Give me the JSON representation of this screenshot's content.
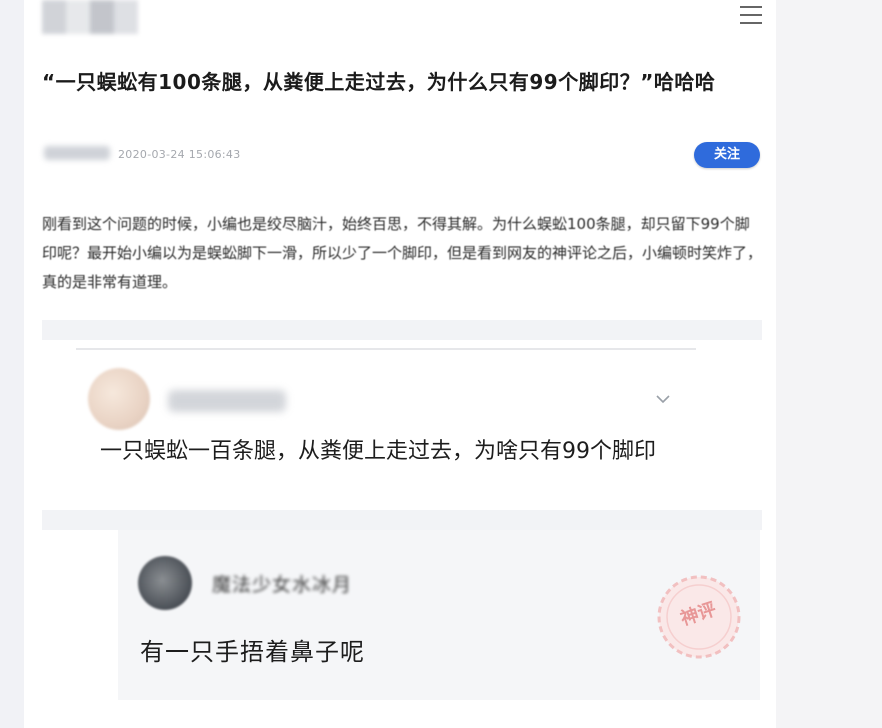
{
  "post": {
    "title": "“一只蜈蚣有100条腿，从粪便上走过去，为什么只有99个脚印？”哈哈哈",
    "timestamp": "2020-03-24 15:06:43",
    "follow_label": "关注",
    "body": "刚看到这个问题的时候，小编也是绞尽脑汁，始终百思，不得其解。为什么蜈蚣100条腿，却只留下99个脚印呢？最开始小编以为是蜈蚣脚下一滑，所以少了一个脚印，但是看到网友的神评论之后，小编顿时笑炸了，真的是非常有道理。"
  },
  "comment": {
    "text": "一只蜈蚣一百条腿，从粪便上走过去，为啥只有99个脚印"
  },
  "reply": {
    "name": "魔法少女水冰月",
    "text": "有一只手捂着鼻子呢",
    "stamp": "神评"
  },
  "colors": {
    "accent": "#2f6bdc",
    "stamp": "#e58a8a"
  }
}
